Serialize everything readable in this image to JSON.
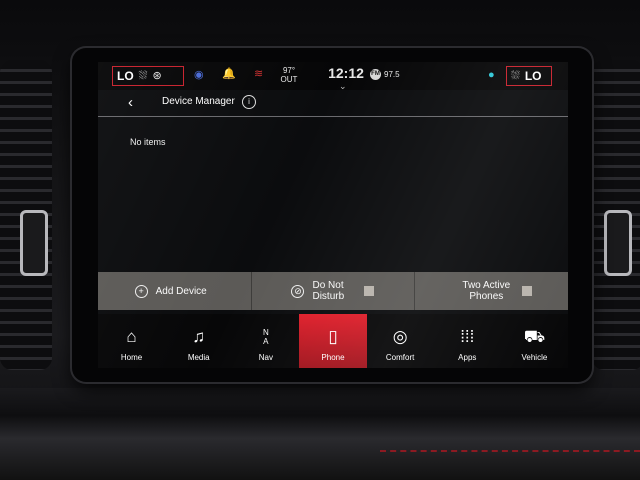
{
  "status_bar": {
    "left_climate": {
      "label": "LO",
      "icons": [
        "seat-heat-icon",
        "steering-wheel-heat-icon"
      ]
    },
    "indicator_icons": [
      "voice-icon",
      "notification-bell-icon",
      "wifi-icon"
    ],
    "outside_temp": {
      "value": "97°",
      "label": "OUT"
    },
    "clock": "12:12",
    "radio": {
      "badge": "FM",
      "station": "97.5"
    },
    "right_climate": {
      "label": "LO",
      "icons": [
        "seat-heat-icon"
      ]
    },
    "right_indicator_icon": "alexa-icon"
  },
  "header": {
    "title": "Device Manager",
    "back_icon": "back-arrow-icon",
    "info_icon": "info-icon"
  },
  "content": {
    "empty_message": "No items"
  },
  "actions": [
    {
      "label": "Add Device",
      "icon": "plus-circle-icon"
    },
    {
      "label": "Do Not Disturb",
      "icon": "do-not-disturb-icon",
      "checked": false
    },
    {
      "label": "Two Active Phones",
      "checked": false
    }
  ],
  "nav": {
    "active": "Phone",
    "items": [
      {
        "label": "Home",
        "icon": "home-icon"
      },
      {
        "label": "Media",
        "icon": "music-note-icon"
      },
      {
        "label": "Nav",
        "icon": "compass-icon",
        "compass_letters": [
          "N",
          "A"
        ]
      },
      {
        "label": "Phone",
        "icon": "phone-icon"
      },
      {
        "label": "Comfort",
        "icon": "comfort-icon"
      },
      {
        "label": "Apps",
        "icon": "apps-grid-icon"
      },
      {
        "label": "Vehicle",
        "icon": "vehicle-icon"
      }
    ]
  },
  "colors": {
    "accent_red": "#e01f2b",
    "action_bar": "#5c5a57",
    "screen_bg": "#0b0c0e"
  }
}
